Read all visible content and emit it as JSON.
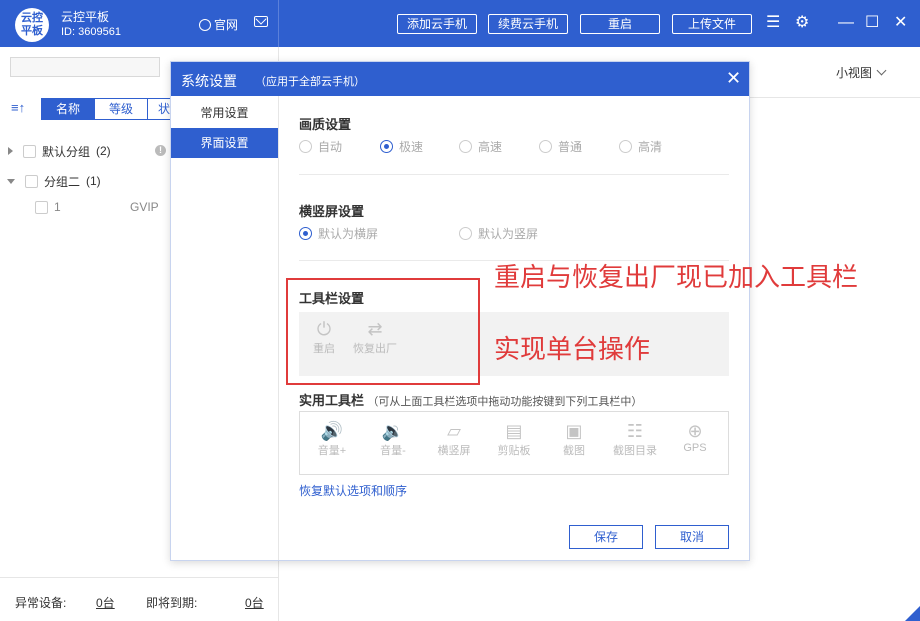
{
  "app": {
    "logo_text": "云控平板",
    "title": "云控平板",
    "id_label": "ID: 3609561",
    "site_link": "官网"
  },
  "header_buttons": {
    "add_phone": "添加云手机",
    "renew_phone": "续费云手机",
    "restart": "重启",
    "upload": "上传文件"
  },
  "left": {
    "sort_icon": "≡↑",
    "tabs": [
      "名称",
      "等级",
      "状"
    ],
    "groups": [
      {
        "name": "默认分组",
        "count": "(2)"
      },
      {
        "name": "分组二",
        "count": "(1)"
      }
    ],
    "device": {
      "name": "1",
      "level": "GVIP"
    },
    "footer": {
      "abnormal_label": "异常设备:",
      "abnormal_value": "0台",
      "expiring_label": "即将到期:",
      "expiring_value": "0台"
    }
  },
  "right": {
    "view_mode": "小视图"
  },
  "modal": {
    "title": "系统设置",
    "subtitle": "（应用于全部云手机）",
    "close": "✕",
    "nav": [
      "常用设置",
      "界面设置"
    ],
    "quality": {
      "title": "画质设置",
      "options": [
        "自动",
        "极速",
        "高速",
        "普通",
        "高清"
      ],
      "selected": "极速"
    },
    "orientation": {
      "title": "横竖屏设置",
      "options": [
        "默认为横屏",
        "默认为竖屏"
      ],
      "selected": "默认为横屏"
    },
    "toolbar": {
      "title": "工具栏设置",
      "items": [
        {
          "icon": "power-icon",
          "label": "重启"
        },
        {
          "icon": "reset-icon",
          "label": "恢复出厂"
        }
      ]
    },
    "util": {
      "title": "实用工具栏",
      "hint": "（可从上面工具栏选项中拖动功能按键到下列工具栏中）",
      "items": [
        {
          "icon": "volume-up-icon",
          "label": "音量+"
        },
        {
          "icon": "volume-down-icon",
          "label": "音量-"
        },
        {
          "icon": "rotate-icon",
          "label": "横竖屏"
        },
        {
          "icon": "clipboard-icon",
          "label": "剪贴板"
        },
        {
          "icon": "screenshot-icon",
          "label": "截图"
        },
        {
          "icon": "screenshot-dir-icon",
          "label": "截图目录"
        },
        {
          "icon": "gps-icon",
          "label": "GPS"
        }
      ]
    },
    "restore_link": "恢复默认选项和顺序",
    "save": "保存",
    "cancel": "取消"
  },
  "annotations": {
    "line1": "重启与恢复出厂现已加入工具栏",
    "line2": "实现单台操作"
  },
  "colors": {
    "brand": "#2f5fcf",
    "annotation": "#e03b3b"
  }
}
